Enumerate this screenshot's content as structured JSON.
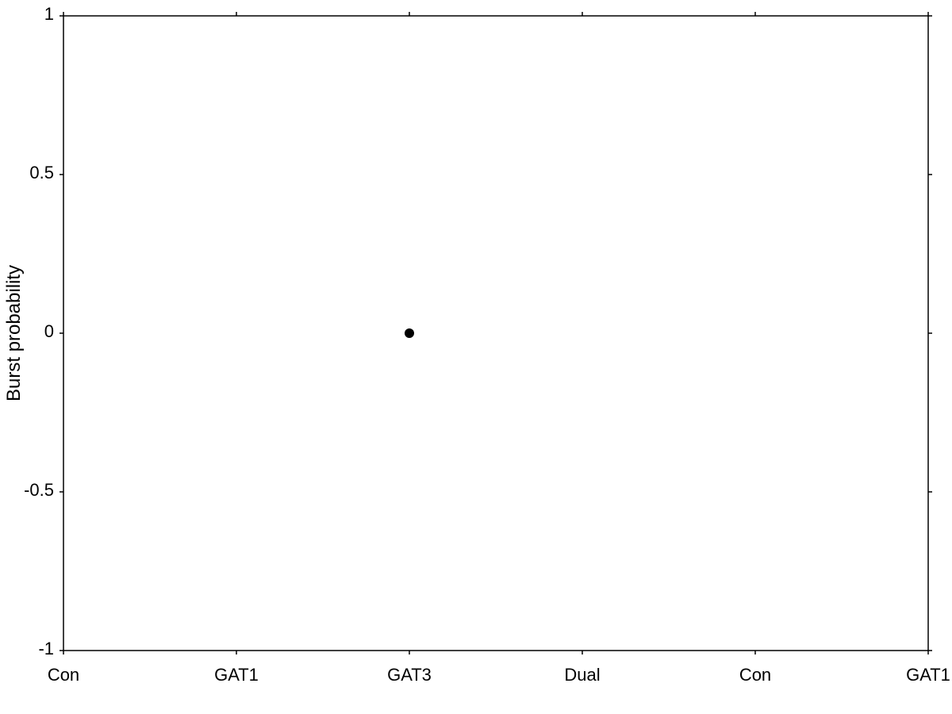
{
  "chart": {
    "title": "",
    "y_axis_label": "Burst probability",
    "x_axis_labels": [
      "Con",
      "GAT1",
      "GAT3",
      "Dual",
      "Con",
      "GAT1"
    ],
    "y_axis_ticks": [
      "1",
      "0.5",
      "0",
      "-0.5",
      "-1"
    ],
    "y_min": -1,
    "y_max": 1,
    "data_points": [
      {
        "x_label": "GAT3",
        "x_index": 2,
        "y": 0.0
      }
    ],
    "colors": {
      "axes": "#000000",
      "grid": "#000000",
      "data_point": "#000000",
      "background": "#ffffff"
    }
  }
}
